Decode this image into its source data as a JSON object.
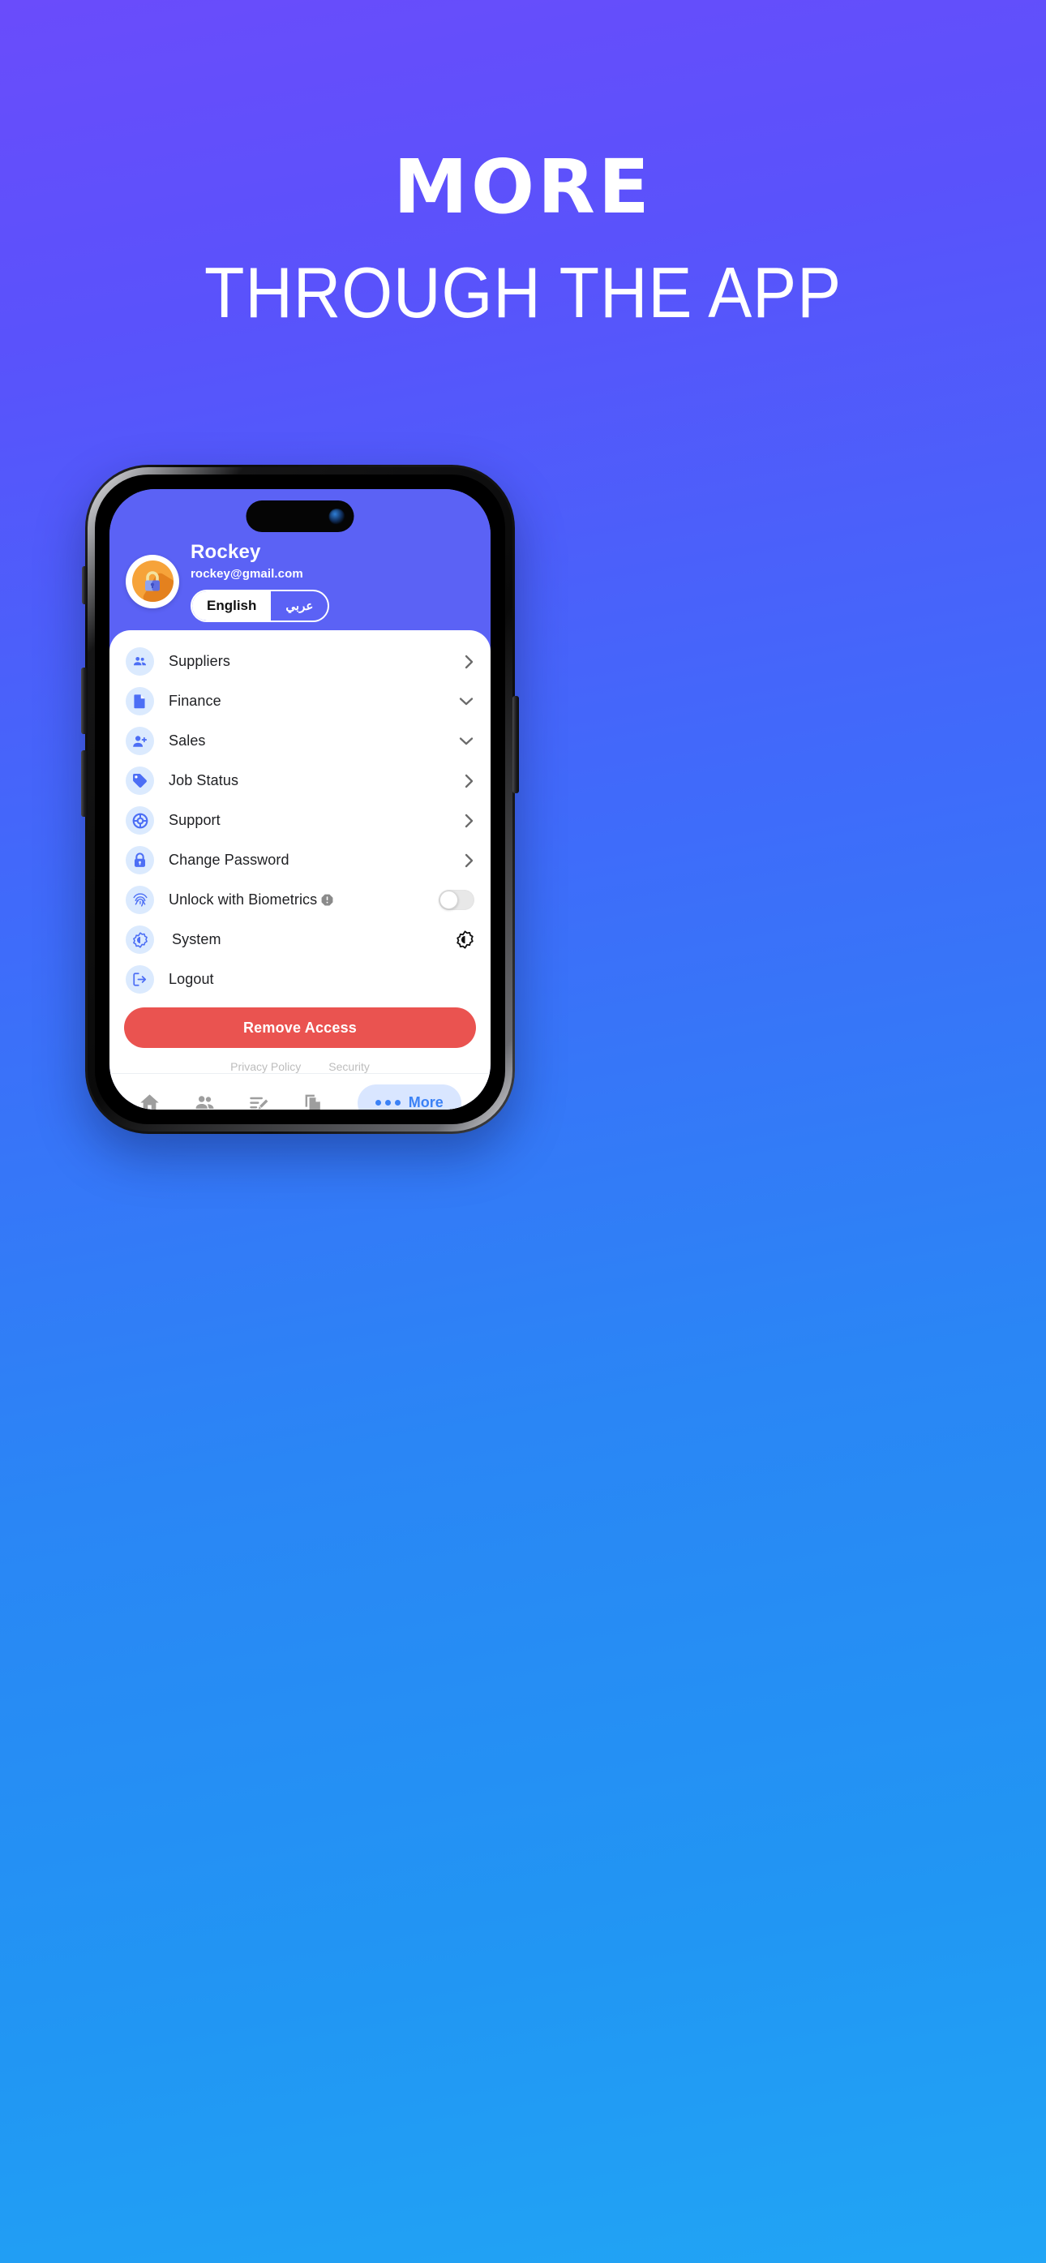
{
  "promo": {
    "line1": "MORE",
    "line2": "THROUGH THE APP"
  },
  "colors": {
    "brand_purple": "#5b62f5",
    "gradient_top": "#6a4cfb",
    "gradient_bottom": "#21a5f5",
    "accent_blue": "#3b82f6",
    "icon_bg": "#dbeafe",
    "danger_red": "#ea5350",
    "more_pill_bg": "#d9e6ff"
  },
  "app": {
    "profile": {
      "name": "Rockey",
      "email": "rockey@gmail.com",
      "avatar_icon": "padlock-avatar-icon"
    },
    "language_toggle": {
      "options": [
        {
          "label": "English",
          "active": true
        },
        {
          "label": "عربي",
          "active": false
        }
      ]
    },
    "menu": [
      {
        "label": "Suppliers",
        "icon": "people-icon",
        "accessory": "chevron-right"
      },
      {
        "label": "Finance",
        "icon": "document-icon",
        "accessory": "chevron-down"
      },
      {
        "label": "Sales",
        "icon": "person-add-icon",
        "accessory": "chevron-down"
      },
      {
        "label": "Job Status",
        "icon": "tag-icon",
        "accessory": "chevron-right"
      },
      {
        "label": "Support",
        "icon": "lifebuoy-icon",
        "accessory": "chevron-right"
      },
      {
        "label": "Change Password",
        "icon": "lock-icon",
        "accessory": "chevron-right"
      },
      {
        "label": "Unlock with Biometrics",
        "icon": "fingerprint-icon",
        "accessory": "switch",
        "switch_on": false,
        "info_badge": "info-icon"
      },
      {
        "label": "System",
        "icon": "brightness-icon",
        "accessory": "theme-icon"
      },
      {
        "label": "Logout",
        "icon": "logout-icon",
        "accessory": "none"
      }
    ],
    "remove_access_label": "Remove Access",
    "legal_links": [
      "Privacy Policy",
      "Security"
    ],
    "bottom_nav": [
      {
        "label": "",
        "icon": "home-icon",
        "active": false
      },
      {
        "label": "",
        "icon": "people-icon",
        "active": false
      },
      {
        "label": "",
        "icon": "edit-list-icon",
        "active": false
      },
      {
        "label": "",
        "icon": "copy-icon",
        "active": false
      },
      {
        "label": "More",
        "icon": "dots-icon",
        "active": true
      }
    ]
  }
}
